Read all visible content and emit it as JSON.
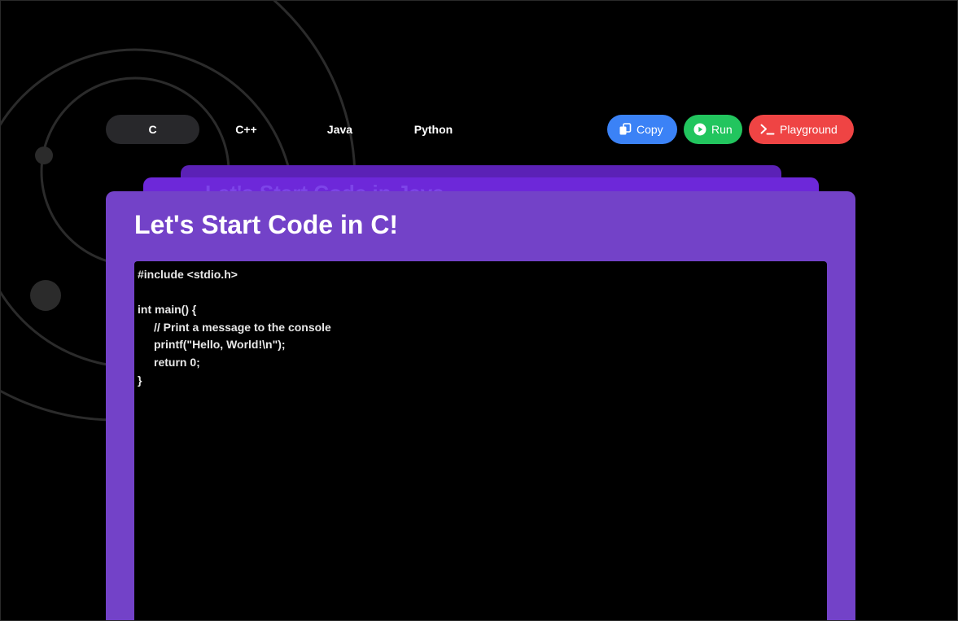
{
  "tabs": [
    {
      "label": "C",
      "active": true
    },
    {
      "label": "C++",
      "active": false
    },
    {
      "label": "Java",
      "active": false
    },
    {
      "label": "Python",
      "active": false
    }
  ],
  "actions": {
    "copy": {
      "label": "Copy",
      "icon": "copy-icon",
      "color": "#3b82f6"
    },
    "run": {
      "label": "Run",
      "icon": "play-icon",
      "color": "#22c55e"
    },
    "playground": {
      "label": "Playground",
      "icon": "terminal-icon",
      "color": "#ef4444"
    }
  },
  "cards": {
    "behind_title": "Let's Start Code in Java",
    "main_title": "Let's Start Code in C!"
  },
  "code": {
    "lines": [
      "#include <stdio.h>",
      "",
      "int main() {",
      "// Print a message to the console",
      "printf(\"Hello, World!\\n\");",
      "return 0;",
      "}"
    ]
  },
  "colors": {
    "background": "#000000",
    "card_main": "#7342c8",
    "card_behind": "#6d28d9",
    "card_behind_far": "#5b21b6",
    "tab_active": "#28282b"
  }
}
